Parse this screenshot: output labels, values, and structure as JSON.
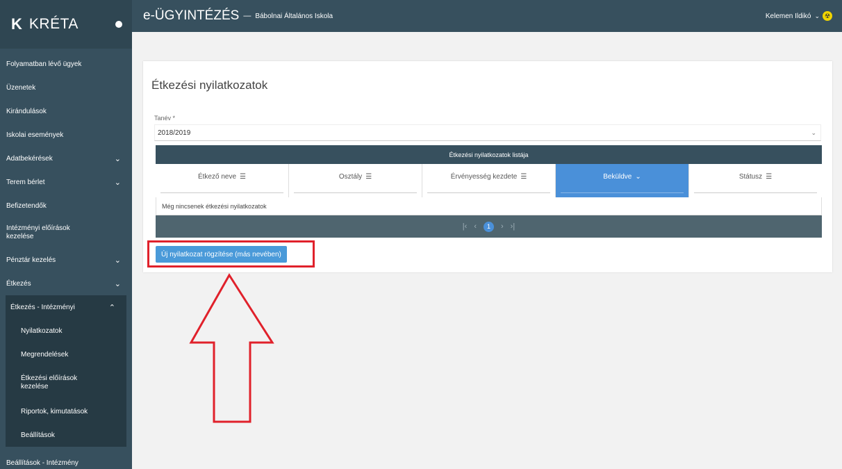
{
  "brand": {
    "logo": "K",
    "name": "KRÉTA"
  },
  "topbar": {
    "app_title": "e-ÜGYINTÉZÉS",
    "separator": "—",
    "school": "Bábolnai Általános Iskola",
    "user_name": "Kelemen Ildikó"
  },
  "sidebar": {
    "items": [
      {
        "label": "Folyamatban lévő ügyek"
      },
      {
        "label": "Üzenetek"
      },
      {
        "label": "Kirándulások"
      },
      {
        "label": "Iskolai események"
      },
      {
        "label": "Adatbekérések"
      },
      {
        "label": "Terem bérlet"
      },
      {
        "label": "Befizetendők"
      },
      {
        "label": "Intézményi előírások kezelése"
      },
      {
        "label": "Pénztár kezelés"
      },
      {
        "label": "Étkezés"
      },
      {
        "label": "Étkezés - Intézményi"
      }
    ],
    "submenu": [
      {
        "label": "Nyilatkozatok"
      },
      {
        "label": "Megrendelések"
      },
      {
        "label": "Étkezési előírások kezelése"
      },
      {
        "label": "Riportok, kimutatások"
      },
      {
        "label": "Beállítások"
      }
    ],
    "bottom_item": "Beállítások - Intézmény"
  },
  "page": {
    "title": "Étkezési nyilatkozatok",
    "field_label": "Tanév *",
    "school_year": "2018/2019"
  },
  "grid": {
    "header": "Étkezési nyilatkozatok listája",
    "columns": [
      "Étkező neve",
      "Osztály",
      "Érvényesség kezdete",
      "Beküldve",
      "Státusz"
    ],
    "active_column": 3,
    "empty_message": "Még nincsenek étkezési nyilatkozatok",
    "current_page": "1"
  },
  "actions": {
    "new_label": "Új nyilatkozat rögzítése (más nevében)"
  },
  "colors": {
    "header": "#37505e",
    "accent": "#4a90d9",
    "highlight": "#e0212b"
  }
}
